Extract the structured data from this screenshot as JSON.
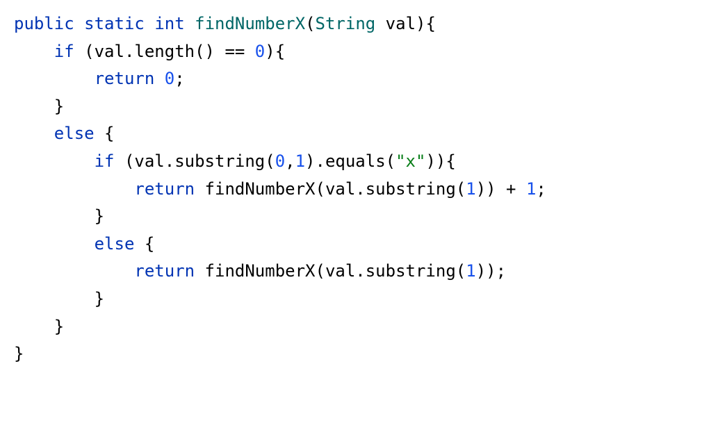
{
  "code": {
    "line1": {
      "kw_public": "public",
      "kw_static": "static",
      "kw_int": "int",
      "method_name": "findNumberX",
      "paren_open": "(",
      "type_string": "String",
      "param": " val)",
      "brace": "{"
    },
    "line2": {
      "indent": "    ",
      "kw_if": "if",
      "expr": " (val.length() == ",
      "num_zero": "0",
      "close": "){"
    },
    "line3": {
      "indent": "        ",
      "kw_return": "return",
      "space": " ",
      "num_zero": "0",
      "semi": ";"
    },
    "line4": {
      "indent": "    ",
      "brace": "}"
    },
    "line5": {
      "indent": "    ",
      "kw_else": "else",
      "brace": " {"
    },
    "line6": {
      "indent": "        ",
      "kw_if": "if",
      "expr1": " (val.substring(",
      "num_a": "0",
      "comma": ",",
      "num_b": "1",
      "expr2": ").equals(",
      "str_x": "\"x\"",
      "close": ")){"
    },
    "line7": {
      "indent": "            ",
      "kw_return": "return",
      "space": " ",
      "call": "findNumberX(val.substring(",
      "num_one": "1",
      "close": ")) + ",
      "num_one2": "1",
      "semi": ";"
    },
    "line8": {
      "indent": "        ",
      "brace": "}"
    },
    "line9": {
      "indent": "        ",
      "kw_else": "else",
      "brace": " {"
    },
    "line10": {
      "indent": "            ",
      "kw_return": "return",
      "space": " ",
      "call": "findNumberX(val.substring(",
      "num_one": "1",
      "close": "));"
    },
    "line11": {
      "indent": "        ",
      "brace": "}"
    },
    "line12": {
      "indent": "    ",
      "brace": "}"
    },
    "line13": {
      "brace": "}"
    }
  }
}
